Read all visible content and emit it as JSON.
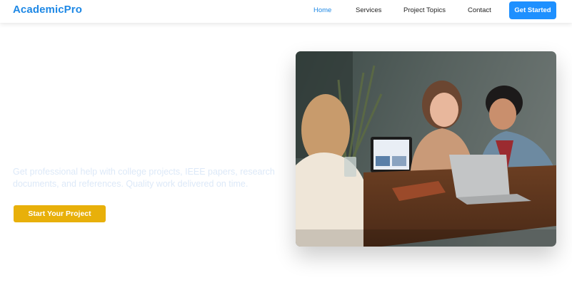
{
  "brand": "AcademicPro",
  "nav": {
    "links": [
      "Home",
      "Services",
      "Project Topics",
      "Contact"
    ],
    "cta": "Get Started"
  },
  "hero": {
    "text": "Get professional help with college projects, IEEE papers, research documents, and references. Quality work delivered on time.",
    "button": "Start Your Project",
    "image": "students-laptops-photo"
  },
  "colors": {
    "brand": "#1e88e5",
    "cta": "#1e90ff",
    "accent_button": "#e8b00a",
    "hero_text": "#dde9f8"
  }
}
